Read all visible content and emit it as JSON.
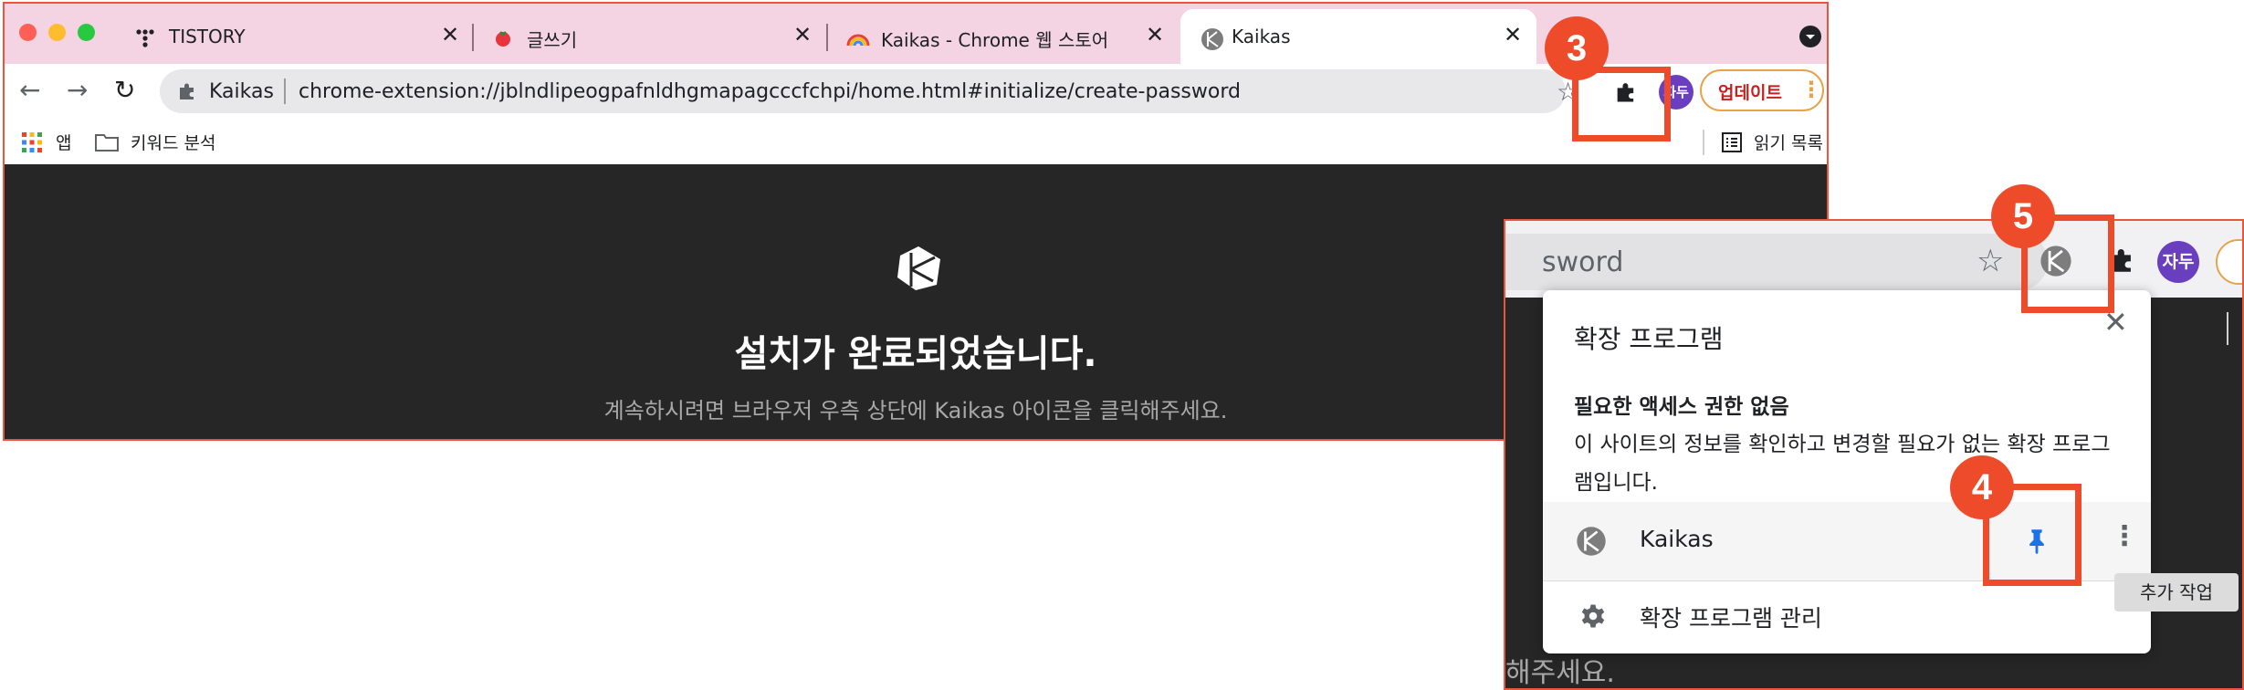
{
  "window": {
    "tabs": [
      {
        "label": "TISTORY",
        "icon": "tistory-icon"
      },
      {
        "label": "글쓰기",
        "icon": "tomato-icon"
      },
      {
        "label": "Kaikas - Chrome 웹 스토어",
        "icon": "rainbow-icon"
      },
      {
        "label": "Kaikas",
        "icon": "kaikas-icon",
        "active": true
      }
    ],
    "tab_close": "✕",
    "address_bar": {
      "site_label": "Kaikas",
      "url": "chrome-extension://jblndlipeogpafnldhgmapagcccfchpi/home.html#initialize/create-password"
    },
    "profile_avatar": "자두",
    "update_button": "업데이트",
    "bookmarks": {
      "apps_label": "앱",
      "folder_label": "키워드 분석",
      "reading_list_label": "읽기 목록"
    }
  },
  "page": {
    "title": "설치가 완료되었습니다.",
    "subtitle": "계속하시려면 브라우저 우측 상단에 Kaikas 아이콘을 클릭해주세요."
  },
  "inset": {
    "url_fragment": "sword",
    "avatar": "자두",
    "bottom_text": "해주세요.",
    "popup": {
      "title": "확장 프로그램",
      "subhead": "필요한 액세스 권한 없음",
      "description": "이 사이트의 정보를 확인하고 변경할 필요가 없는 확장 프로그램입니다.",
      "extension_name": "Kaikas",
      "manage_label": "확장 프로그램 관리",
      "tooltip": "추가 작업"
    }
  },
  "callouts": [
    "3",
    "4",
    "5"
  ],
  "colors": {
    "accent_red": "#ee4b2b",
    "tabbar": "#f4d3e3",
    "page_bg": "#262626",
    "avatar": "#6a3fbf",
    "pin_blue": "#1a73e8"
  }
}
